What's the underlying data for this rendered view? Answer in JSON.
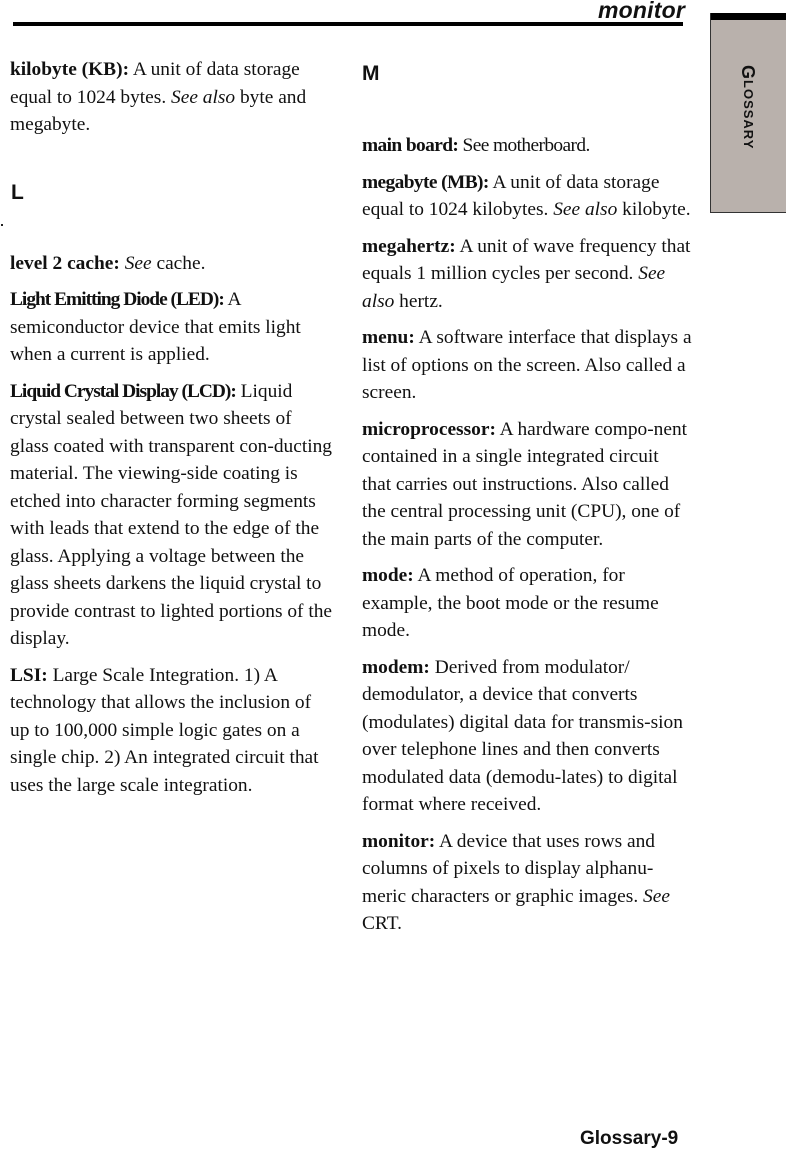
{
  "header": {
    "running_head": "monitor"
  },
  "side_tab": {
    "first_letter": "G",
    "rest": "LOSSARY"
  },
  "sections": {
    "L": {
      "letter": "L"
    },
    "M": {
      "letter": "M"
    }
  },
  "left_column": {
    "kilobyte": {
      "term": "kilobyte (KB):",
      "t1": "  A unit of data storage equal to 1024 bytes.  ",
      "see": "See also",
      "t2": " byte and megabyte."
    },
    "level2": {
      "term": "level 2 cache:",
      "see": "See",
      "t1": " cache."
    },
    "led": {
      "term": "Light Emitting Diode (LED):",
      "t1": " A semiconductor device that emits light when a current is applied."
    },
    "lcd": {
      "term": "Liquid Crystal Display (LCD):",
      "t1": " Liquid crystal sealed between two sheets of glass coated with transparent con-ducting material.  The viewing-side coating is etched into character forming segments with leads that extend to the edge of the glass. Applying a voltage between the glass sheets darkens the liquid crystal to provide contrast to lighted portions of the display."
    },
    "lsi": {
      "term": "LSI:",
      "t1": "  Large Scale Integration.   1) A technology that allows the inclusion of up to 100,000 simple logic gates on a single chip.  2) An integrated circuit that uses the large scale integration."
    }
  },
  "right_column": {
    "mainboard": {
      "term": "main board:",
      "t1": " See motherboard."
    },
    "megabyte": {
      "term": "megabyte (MB):",
      "t1": "  A unit of data storage equal to 1024 kilobytes.  ",
      "see": "See also",
      "t2": " kilobyte."
    },
    "megahertz": {
      "term": "megahertz:",
      "t1": " A unit of wave frequency that equals 1 million cycles per second. ",
      "see": "See also",
      "t2": " hertz."
    },
    "menu": {
      "term": "menu:",
      "t1": "  A software interface that displays a list of options on the screen.  Also called a screen."
    },
    "microprocessor": {
      "term": "microprocessor:",
      "t1": "  A hardware compo-nent contained in a single integrated circuit that carries out instructions. Also called the central processing unit (CPU), one of the main parts of the computer."
    },
    "mode": {
      "term": "mode:",
      "t1": "  A method of operation, for example, the boot mode or the resume mode."
    },
    "modem": {
      "term": "modem:",
      "t1": " Derived from modulator/ demodulator, a device that converts (modulates) digital data for transmis-sion over telephone lines and then converts modulated data (demodu-lates) to digital format where received."
    },
    "monitor": {
      "term": "monitor:",
      "t1": "  A device that uses rows and columns of pixels to display alphanu-meric characters or graphic images. ",
      "see": "See",
      "t2": " CRT."
    }
  },
  "footer": {
    "page_number": "Glossary-9"
  }
}
